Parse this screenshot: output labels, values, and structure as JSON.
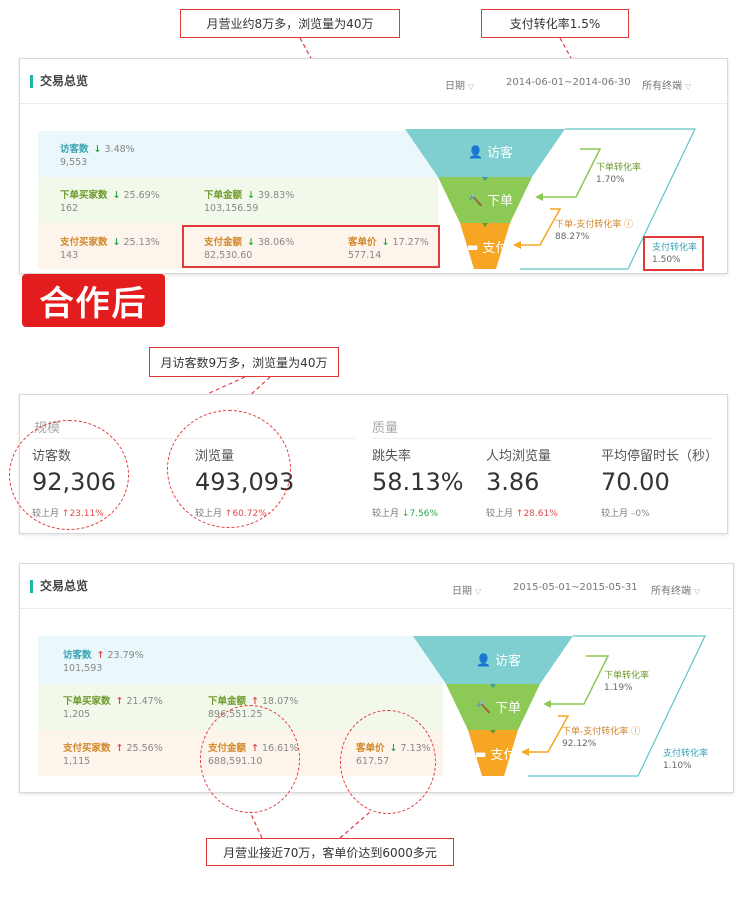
{
  "callouts": {
    "top_left": "月营业约8万多，浏览量为40万",
    "top_right": "支付转化率1.5%",
    "mid": "月访客数9万多，浏览量为40万",
    "bottom": "月营业接近70万，客单价达到6000多元"
  },
  "banner": "合作后",
  "before": {
    "title": "交易总览",
    "date_label": "日期",
    "date_range": "2014-06-01~2014-06-30",
    "terminal": "所有终端",
    "rows": {
      "visitors": {
        "label": "访客数",
        "change": "3.48%",
        "value": "9,553",
        "dir": "down"
      },
      "buyers": {
        "label": "下单买家数",
        "change": "25.69%",
        "value": "162",
        "dir": "down"
      },
      "order_amount": {
        "label": "下单金额",
        "change": "39.83%",
        "value": "103,156.59",
        "dir": "down"
      },
      "pay_buyers": {
        "label": "支付买家数",
        "change": "25.13%",
        "value": "143",
        "dir": "down"
      },
      "pay_amount": {
        "label": "支付金额",
        "change": "38.06%",
        "value": "82,530.60",
        "dir": "down"
      },
      "unit_price": {
        "label": "客单价",
        "change": "17.27%",
        "value": "577.14",
        "dir": "down"
      }
    },
    "funnel": {
      "visit": "访客",
      "order": "下单",
      "pay": "支付"
    },
    "conversions": {
      "order_rate": {
        "label": "下单转化率",
        "value": "1.70%"
      },
      "order_pay_rate": {
        "label": "下单-支付转化率",
        "value": "88.27%"
      },
      "pay_rate": {
        "label": "支付转化率",
        "value": "1.50%"
      }
    }
  },
  "stats": {
    "scale_title": "规模",
    "quality_title": "质量",
    "compare_label": "较上月",
    "items": [
      {
        "label": "访客数",
        "value": "92,306",
        "change": "23.11%",
        "dir": "up"
      },
      {
        "label": "浏览量",
        "value": "493,093",
        "change": "60.72%",
        "dir": "up"
      },
      {
        "label": "跳失率",
        "value": "58.13%",
        "change": "7.56%",
        "dir": "down"
      },
      {
        "label": "人均浏览量",
        "value": "3.86",
        "change": "28.61%",
        "dir": "up"
      },
      {
        "label": "平均停留时长（秒）",
        "value": "70.00",
        "change": "0%",
        "dir": "flat"
      }
    ]
  },
  "after": {
    "title": "交易总览",
    "date_label": "日期",
    "date_range": "2015-05-01~2015-05-31",
    "terminal": "所有终端",
    "rows": {
      "visitors": {
        "label": "访客数",
        "change": "23.79%",
        "value": "101,593",
        "dir": "up"
      },
      "buyers": {
        "label": "下单买家数",
        "change": "21.47%",
        "value": "1,205",
        "dir": "up"
      },
      "order_amount": {
        "label": "下单金额",
        "change": "18.07%",
        "value": "896,551.25",
        "dir": "up"
      },
      "pay_buyers": {
        "label": "支付买家数",
        "change": "25.56%",
        "value": "1,115",
        "dir": "up"
      },
      "pay_amount": {
        "label": "支付金额",
        "change": "16.61%",
        "value": "688,591.10",
        "dir": "up"
      },
      "unit_price": {
        "label": "客单价",
        "change": "7.13%",
        "value": "617.57",
        "dir": "down"
      }
    },
    "funnel": {
      "visit": "访客",
      "order": "下单",
      "pay": "支付"
    },
    "conversions": {
      "order_rate": {
        "label": "下单转化率",
        "value": "1.19%"
      },
      "order_pay_rate": {
        "label": "下单-支付转化率",
        "value": "92.12%"
      },
      "pay_rate": {
        "label": "支付转化率",
        "value": "1.10%"
      }
    }
  },
  "colors": {
    "accent_red": "#e23a3a",
    "funnel_visit": "#7fcfd0",
    "funnel_order": "#8cc955",
    "funnel_pay": "#f6a623",
    "row_visit": "#eaf7fb",
    "row_order": "#f3f9ea",
    "row_pay": "#fdf5ec",
    "label_visit": "#3aa3b5",
    "label_order": "#6f9a2d",
    "label_pay": "#d1872a"
  },
  "icons": {
    "visit": "user-icon",
    "order": "hammer-icon",
    "pay": "card-icon",
    "down": "arrow-down-icon",
    "up": "arrow-up-icon"
  }
}
